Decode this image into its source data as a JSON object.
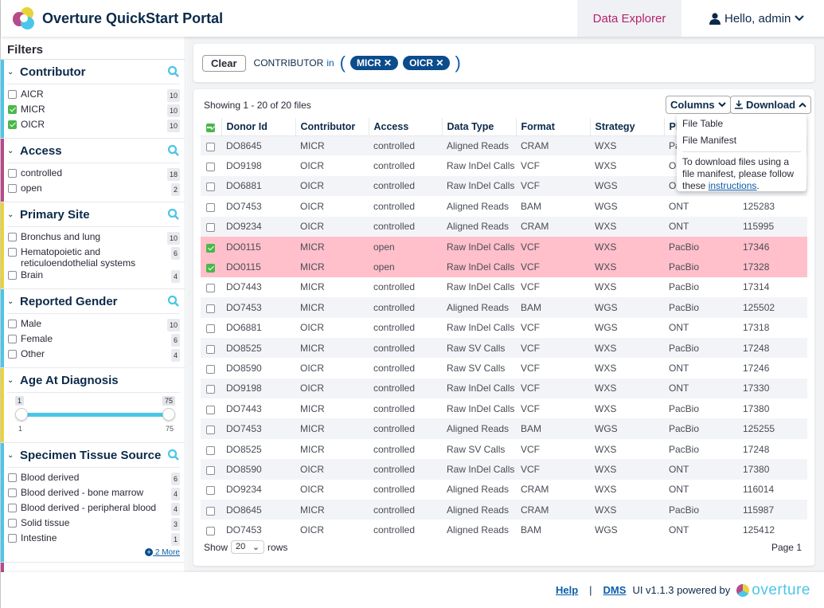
{
  "header": {
    "title": "Overture QuickStart Portal",
    "nav_tab": "Data Explorer",
    "user": "Hello, admin"
  },
  "sidebar": {
    "title": "Filters",
    "facets": [
      {
        "title": "Contributor",
        "color": "#4bc6e8",
        "options": [
          {
            "label": "AICR",
            "count": "10",
            "checked": false
          },
          {
            "label": "MICR",
            "count": "10",
            "checked": true
          },
          {
            "label": "OICR",
            "count": "10",
            "checked": true
          }
        ]
      },
      {
        "title": "Access",
        "color": "#b74a89",
        "options": [
          {
            "label": "controlled",
            "count": "18",
            "checked": false
          },
          {
            "label": "open",
            "count": "2",
            "checked": false
          }
        ]
      },
      {
        "title": "Primary Site",
        "color": "#ead339",
        "options": [
          {
            "label": "Bronchus and lung",
            "count": "10",
            "checked": false
          },
          {
            "label": "Hematopoietic and reticuloendothelial systems",
            "count": "6",
            "checked": false
          },
          {
            "label": "Brain",
            "count": "4",
            "checked": false
          }
        ]
      },
      {
        "title": "Reported Gender",
        "color": "#4bc6e8",
        "options": [
          {
            "label": "Male",
            "count": "10",
            "checked": false
          },
          {
            "label": "Female",
            "count": "6",
            "checked": false
          },
          {
            "label": "Other",
            "count": "4",
            "checked": false
          }
        ]
      }
    ],
    "age": {
      "title": "Age At Diagnosis",
      "color": "#ead339",
      "min": "1",
      "max": "75",
      "selected_min": "1",
      "selected_max": "75"
    },
    "specimen": {
      "title": "Specimen Tissue Source",
      "color": "#4bc6e8",
      "options": [
        {
          "label": "Blood derived",
          "count": "6"
        },
        {
          "label": "Blood derived - bone marrow",
          "count": "4"
        },
        {
          "label": "Blood derived - peripheral blood",
          "count": "4"
        },
        {
          "label": "Solid tissue",
          "count": "3"
        },
        {
          "label": "Intestine",
          "count": "1"
        }
      ],
      "more": "2 More"
    }
  },
  "sqon": {
    "clear": "Clear",
    "field": "CONTRIBUTOR",
    "op": "in",
    "values": [
      "MICR",
      "OICR"
    ]
  },
  "table": {
    "showing": "Showing 1 - 20 of 20 files",
    "columns_btn": "Columns",
    "download_btn": "Download",
    "headers": [
      "Donor Id",
      "Contributor",
      "Access",
      "Data Type",
      "Format",
      "Strategy",
      "Pla",
      ""
    ],
    "rows": [
      [
        "DO8645",
        "MICR",
        "controlled",
        "Aligned Reads",
        "CRAM",
        "WXS",
        "PacBio",
        ""
      ],
      [
        "DO9198",
        "OICR",
        "controlled",
        "Raw InDel Calls",
        "VCF",
        "WXS",
        "ONT",
        ""
      ],
      [
        "DO6881",
        "OICR",
        "controlled",
        "Raw InDel Calls",
        "VCF",
        "WGS",
        "ONT",
        ""
      ],
      [
        "DO7453",
        "OICR",
        "controlled",
        "Aligned Reads",
        "BAM",
        "WGS",
        "ONT",
        "125283"
      ],
      [
        "DO9234",
        "OICR",
        "controlled",
        "Aligned Reads",
        "CRAM",
        "WXS",
        "ONT",
        "115995"
      ],
      [
        "DO0115",
        "MICR",
        "open",
        "Raw InDel Calls",
        "VCF",
        "WXS",
        "PacBio",
        "17346"
      ],
      [
        "DO0115",
        "MICR",
        "open",
        "Raw InDel Calls",
        "VCF",
        "WXS",
        "PacBio",
        "17328"
      ],
      [
        "DO7443",
        "MICR",
        "controlled",
        "Raw InDel Calls",
        "VCF",
        "WXS",
        "PacBio",
        "17314"
      ],
      [
        "DO7453",
        "MICR",
        "controlled",
        "Aligned Reads",
        "BAM",
        "WGS",
        "PacBio",
        "125502"
      ],
      [
        "DO6881",
        "OICR",
        "controlled",
        "Raw InDel Calls",
        "VCF",
        "WGS",
        "ONT",
        "17318"
      ],
      [
        "DO8525",
        "MICR",
        "controlled",
        "Raw SV Calls",
        "VCF",
        "WXS",
        "PacBio",
        "17248"
      ],
      [
        "DO8590",
        "OICR",
        "controlled",
        "Raw SV Calls",
        "VCF",
        "WXS",
        "ONT",
        "17246"
      ],
      [
        "DO9198",
        "OICR",
        "controlled",
        "Raw InDel Calls",
        "VCF",
        "WXS",
        "ONT",
        "17330"
      ],
      [
        "DO7443",
        "MICR",
        "controlled",
        "Raw InDel Calls",
        "VCF",
        "WXS",
        "PacBio",
        "17380"
      ],
      [
        "DO7453",
        "MICR",
        "controlled",
        "Aligned Reads",
        "BAM",
        "WGS",
        "PacBio",
        "125255"
      ],
      [
        "DO8525",
        "MICR",
        "controlled",
        "Raw SV Calls",
        "VCF",
        "WXS",
        "PacBio",
        "17248"
      ],
      [
        "DO8590",
        "OICR",
        "controlled",
        "Raw InDel Calls",
        "VCF",
        "WXS",
        "ONT",
        "17380"
      ],
      [
        "DO9234",
        "OICR",
        "controlled",
        "Aligned Reads",
        "CRAM",
        "WXS",
        "ONT",
        "116014"
      ],
      [
        "DO8645",
        "MICR",
        "controlled",
        "Aligned Reads",
        "CRAM",
        "WXS",
        "PacBio",
        "115987"
      ],
      [
        "DO7453",
        "OICR",
        "controlled",
        "Aligned Reads",
        "BAM",
        "WGS",
        "ONT",
        "125412"
      ]
    ],
    "selected_rows": [
      5,
      6
    ],
    "dropdown": {
      "items": [
        "File Table",
        "File Manifest"
      ],
      "note_pre": "To download files using a file manifest, please follow these ",
      "note_link": "instructions",
      "note_post": "."
    },
    "show_label": "Show",
    "rows_value": "20",
    "rows_label": "rows",
    "page": "Page 1"
  },
  "footer": {
    "help": "Help",
    "sep": "|",
    "dms": "DMS",
    "version": "UI v1.1.3 powered by",
    "brand": "overture"
  },
  "colors": {
    "selected_row": "#ffc0cb",
    "checkbox": "#49b848",
    "pill": "#0b4c8c",
    "nav_active": "#b4236b"
  }
}
